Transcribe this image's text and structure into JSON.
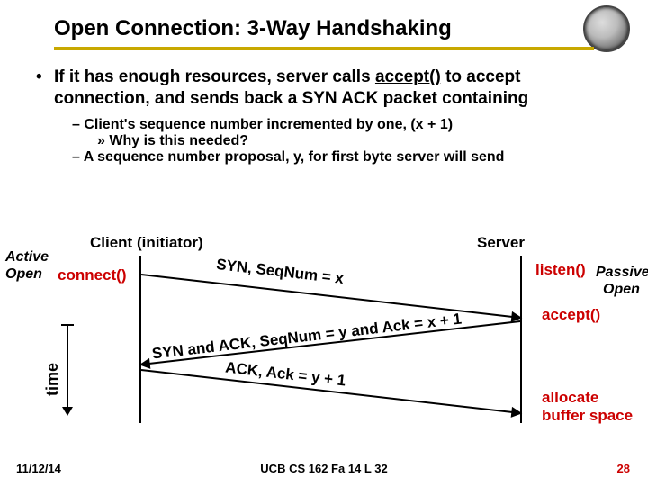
{
  "title": "Open Connection: 3-Way Handshaking",
  "bullet_main_a": "If it has enough resources, server calls ",
  "bullet_main_u": "accept()",
  "bullet_main_b": " to accept connection, and sends back a SYN ACK packet containing",
  "sub_a": "– Client's sequence number incremented by one, (x + 1)",
  "sub_a2": "» Why is this needed?",
  "sub_b": "– A sequence number proposal, y, for first byte server will send",
  "client_label": "Client (initiator)",
  "server_label": "Server",
  "active_open_a": "Active",
  "active_open_b": "Open",
  "passive_open_a": "Passive",
  "passive_open_b": "Open",
  "connect": "connect()",
  "listen": "listen()",
  "accept": "accept()",
  "allocate_a": "allocate",
  "allocate_b": "buffer space",
  "msg1": "SYN, SeqNum = x",
  "msg2": "SYN and ACK, SeqNum = y and Ack = x + 1",
  "msg3": "ACK, Ack = y + 1",
  "time_label": "time",
  "footer_date": "11/12/14",
  "footer_center": "UCB CS 162 Fa 14 L 32",
  "footer_page": "28"
}
